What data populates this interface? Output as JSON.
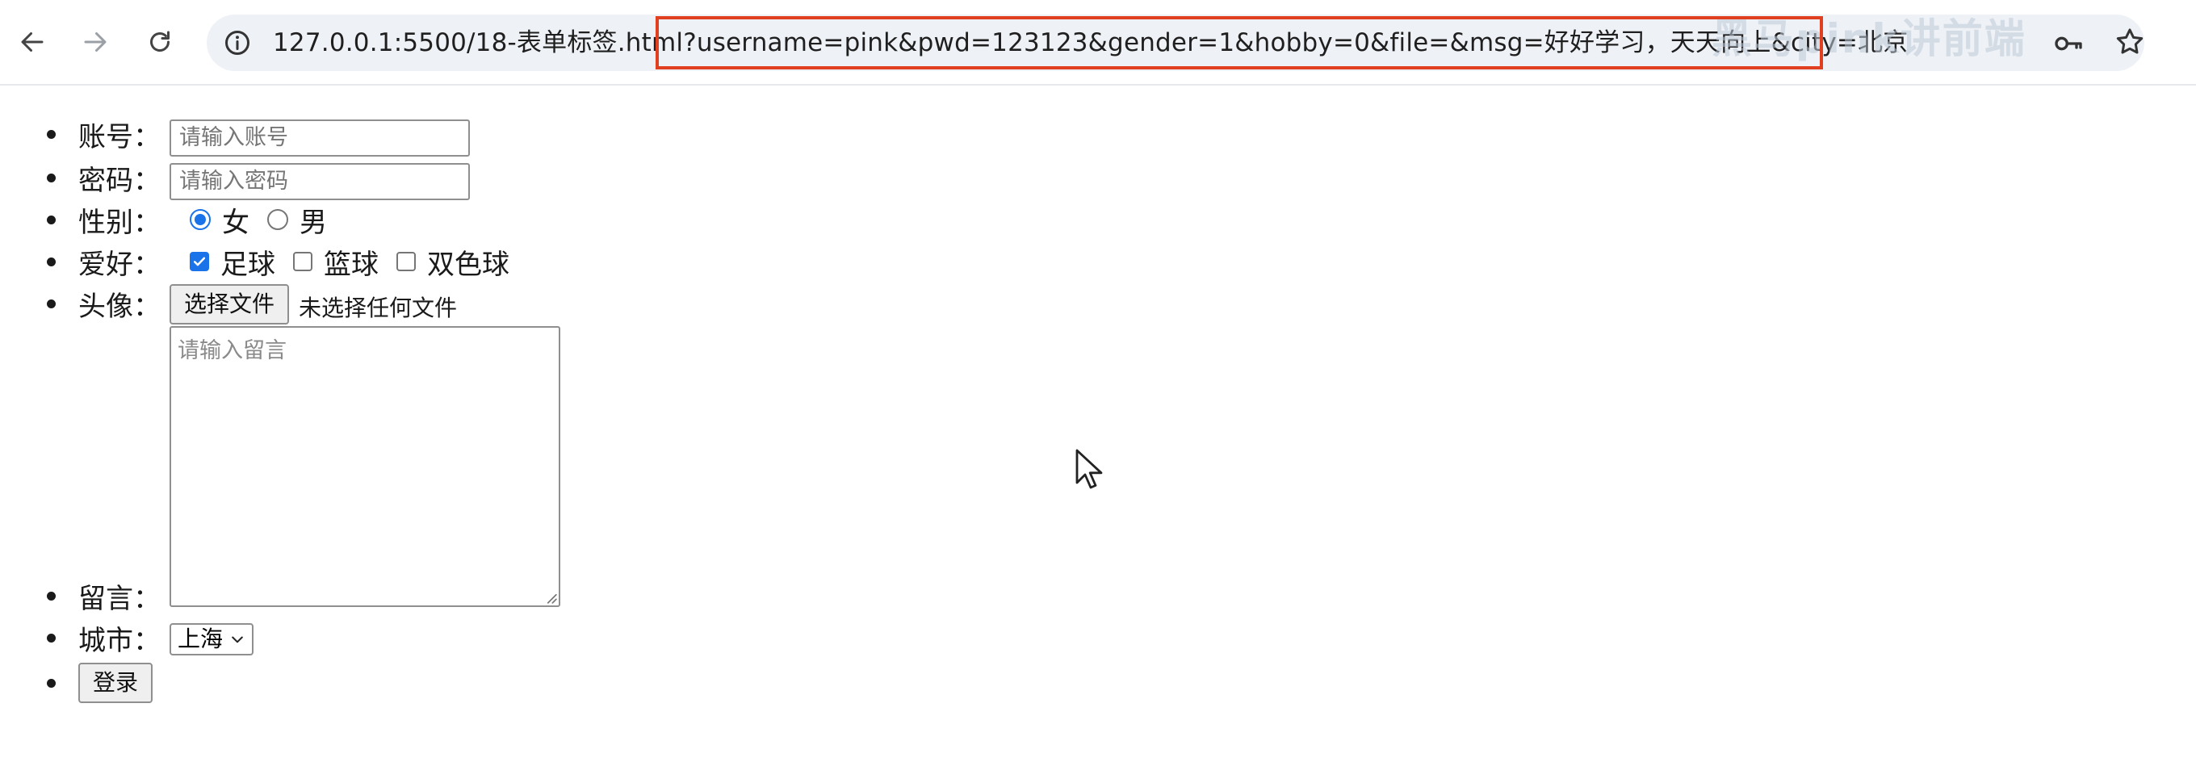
{
  "browser": {
    "url_host": "127.0.0.1:5500/18-表单标签.html",
    "url_query": "?username=pink&pwd=123123&gender=1&hobby=0&file=&msg=好好学习，天天向上&city=北京",
    "watermark": "黑马pink讲前端"
  },
  "form": {
    "username": {
      "label": "账号：",
      "placeholder": "请输入账号"
    },
    "password": {
      "label": "密码：",
      "placeholder": "请输入密码"
    },
    "gender": {
      "label": "性别：",
      "options": [
        {
          "label": "女",
          "checked": true
        },
        {
          "label": "男",
          "checked": false
        }
      ]
    },
    "hobby": {
      "label": "爱好：",
      "options": [
        {
          "label": "足球",
          "checked": true
        },
        {
          "label": "篮球",
          "checked": false
        },
        {
          "label": "双色球",
          "checked": false
        }
      ]
    },
    "avatar": {
      "label": "头像：",
      "button_label": "选择文件",
      "status": "未选择任何文件"
    },
    "message": {
      "label": "留言：",
      "placeholder": "请输入留言"
    },
    "city": {
      "label": "城市：",
      "selected": "上海"
    },
    "submit_label": "登录"
  },
  "colors": {
    "accent": "#1a73e8",
    "highlight_border": "#e0401f"
  }
}
